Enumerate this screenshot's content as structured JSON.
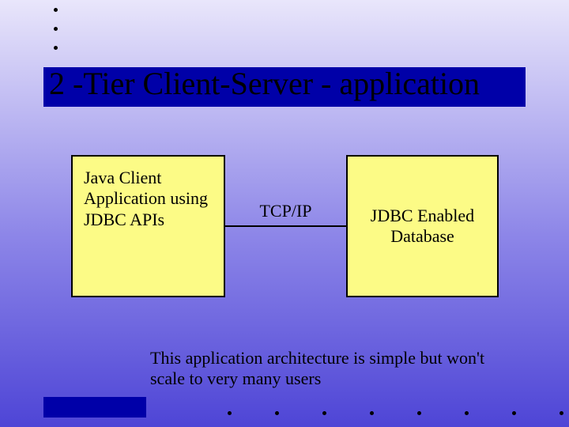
{
  "title": "2 -Tier Client-Server - application",
  "left_box": "Java Client Application using JDBC APIs",
  "right_box": "JDBC Enabled Database",
  "connector_label": "TCP/IP",
  "caption": "This application architecture is simple but won't scale to very many users"
}
